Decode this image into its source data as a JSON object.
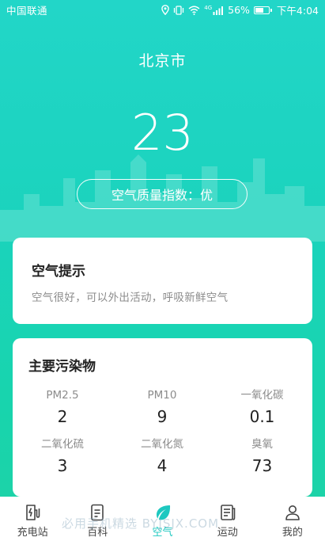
{
  "status_bar": {
    "carrier": "中国联通",
    "signal_label": "4G",
    "battery": "56%",
    "time": "下午4:04",
    "battery_level": 0.56
  },
  "weather": {
    "city": "北京市",
    "temperature": "23",
    "aqi_text": "空气质量指数：优"
  },
  "tip": {
    "title": "空气提示",
    "text": "空气很好，可以外出活动，呼吸新鲜空气"
  },
  "pollutants": {
    "title": "主要污染物",
    "items": [
      {
        "name": "PM2.5",
        "value": "2"
      },
      {
        "name": "PM10",
        "value": "9"
      },
      {
        "name": "一氧化碳",
        "value": "0.1"
      },
      {
        "name": "二氧化硫",
        "value": "3"
      },
      {
        "name": "二氧化氮",
        "value": "4"
      },
      {
        "name": "臭氧",
        "value": "73"
      }
    ]
  },
  "nav": {
    "items": [
      {
        "label": "充电站",
        "icon": "charging-station-icon"
      },
      {
        "label": "百科",
        "icon": "encyclopedia-icon"
      },
      {
        "label": "空气",
        "icon": "leaf-icon",
        "active": true
      },
      {
        "label": "运动",
        "icon": "sport-document-icon"
      },
      {
        "label": "我的",
        "icon": "profile-icon"
      }
    ]
  },
  "watermark": "必用手机精选 BYJSJX.COM",
  "colors": {
    "accent": "#1ec8c0",
    "gradient_top": "#22d6c8",
    "gradient_bottom": "#1ed2a6"
  }
}
